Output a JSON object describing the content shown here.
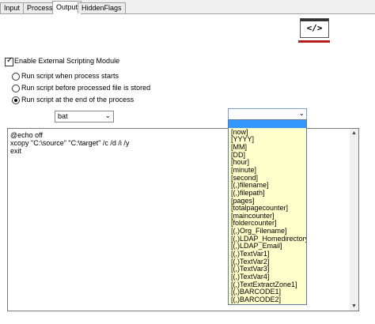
{
  "tabs": {
    "input": "Input",
    "process": "Process",
    "output": "Output",
    "hiddenflags": "HiddenFlags"
  },
  "logo": {
    "text": "</>"
  },
  "options": {
    "enable_label": "Enable External Scripting Module",
    "enable_checked": true,
    "radio_1": "Run script when process starts",
    "radio_2": "Run script before processed file is stored",
    "radio_3": "Run script at the end of the process",
    "selected_radio": 3
  },
  "script_type": {
    "value": "bat"
  },
  "script": {
    "line_1": "@echo off",
    "line_2": "xcopy \"C:\\source\" \"C:\\target\" /c /d /i /y",
    "line_3": "exit"
  },
  "variables": {
    "current": "",
    "items": [
      "",
      "[now]",
      "[YYYY]",
      "[MM]",
      "[DD]",
      "[hour]",
      "[minute]",
      "[second]",
      "[(,)filename]",
      "[(,)filepath]",
      "[pages]",
      "[totalpagecounter]",
      "[maincounter]",
      "[foldercounter]",
      "[(,)Org_Filename]",
      "[(,)LDAP_Homedirectory]",
      "[(,)LDAP_Email]",
      "[(,)TextVar1]",
      "[(,)TextVar2]",
      "[(,)TextVar3]",
      "[(,)TextVar4]",
      "[(,)TextExtractZone1]",
      "[(,)BARCODE1]",
      "[(,)BARCODE2]"
    ]
  }
}
